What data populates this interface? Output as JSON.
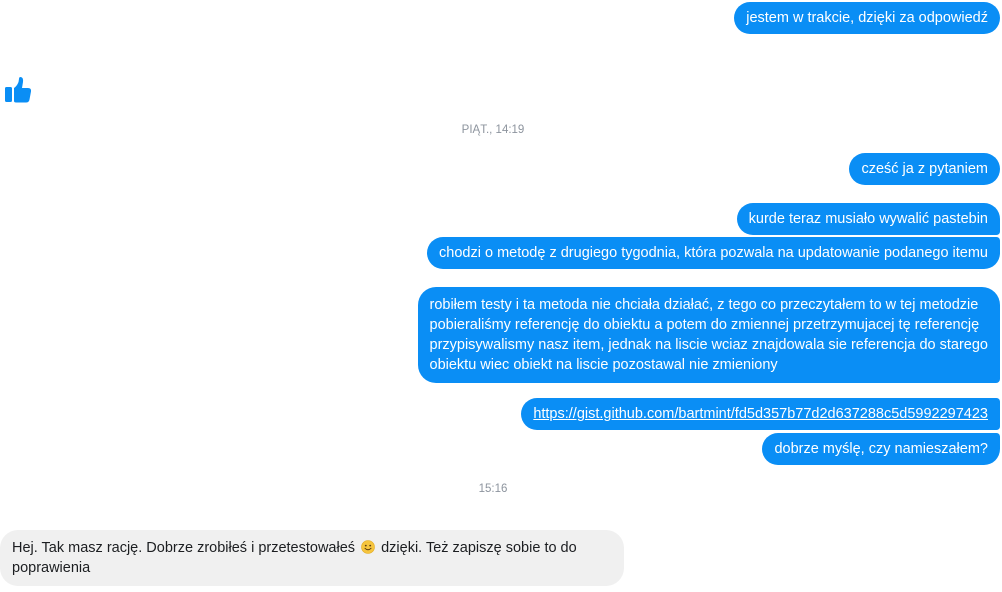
{
  "colors": {
    "outgoing_bubble": "#0a8ef5",
    "incoming_bubble": "#f0f0f0",
    "timestamp_text": "#8d949e",
    "like_icon": "#0a8ef5"
  },
  "messages": [
    {
      "dir": "out",
      "text": "jestem w trakcie, dzięki za odpowiedź"
    },
    {
      "dir": "in",
      "type": "like",
      "icon": "thumbs-up-icon"
    },
    {
      "type": "timestamp",
      "text": "PIĄT., 14:19"
    },
    {
      "dir": "out",
      "text": "cześć ja z pytaniem"
    },
    {
      "dir": "out",
      "text": "kurde teraz musiało wywalić pastebin"
    },
    {
      "dir": "out",
      "text": "chodzi o metodę z drugiego tygodnia, która pozwala na updatowanie podanego itemu"
    },
    {
      "dir": "out",
      "lines": [
        "robiłem testy i ta metoda nie chciała działać, z tego co przeczytałem to w tej metodzie",
        "pobieraliśmy referencję do obiektu a potem do zmiennej przetrzymujacej tę referencję",
        "przypisywalismy nasz item, jednak na liscie wciaz znajdowala sie referencja do starego",
        "obiektu wiec obiekt na liscie pozostawal nie zmieniony"
      ]
    },
    {
      "dir": "out",
      "type": "link",
      "text": "https://gist.github.com/bartmint/fd5d357b77d2d637288c5d5992297423"
    },
    {
      "dir": "out",
      "text": "dobrze myślę, czy namieszałem?"
    },
    {
      "type": "timestamp",
      "text": "15:16"
    },
    {
      "dir": "in",
      "text_before_emoji": "Hej. Tak masz rację. Dobrze zrobiłeś i przetestowałeś",
      "emoji": "slightly-smiling-face-icon",
      "text_after_emoji": "dzięki. Też zapiszę sobie to do",
      "text_line2": "poprawienia"
    }
  ]
}
